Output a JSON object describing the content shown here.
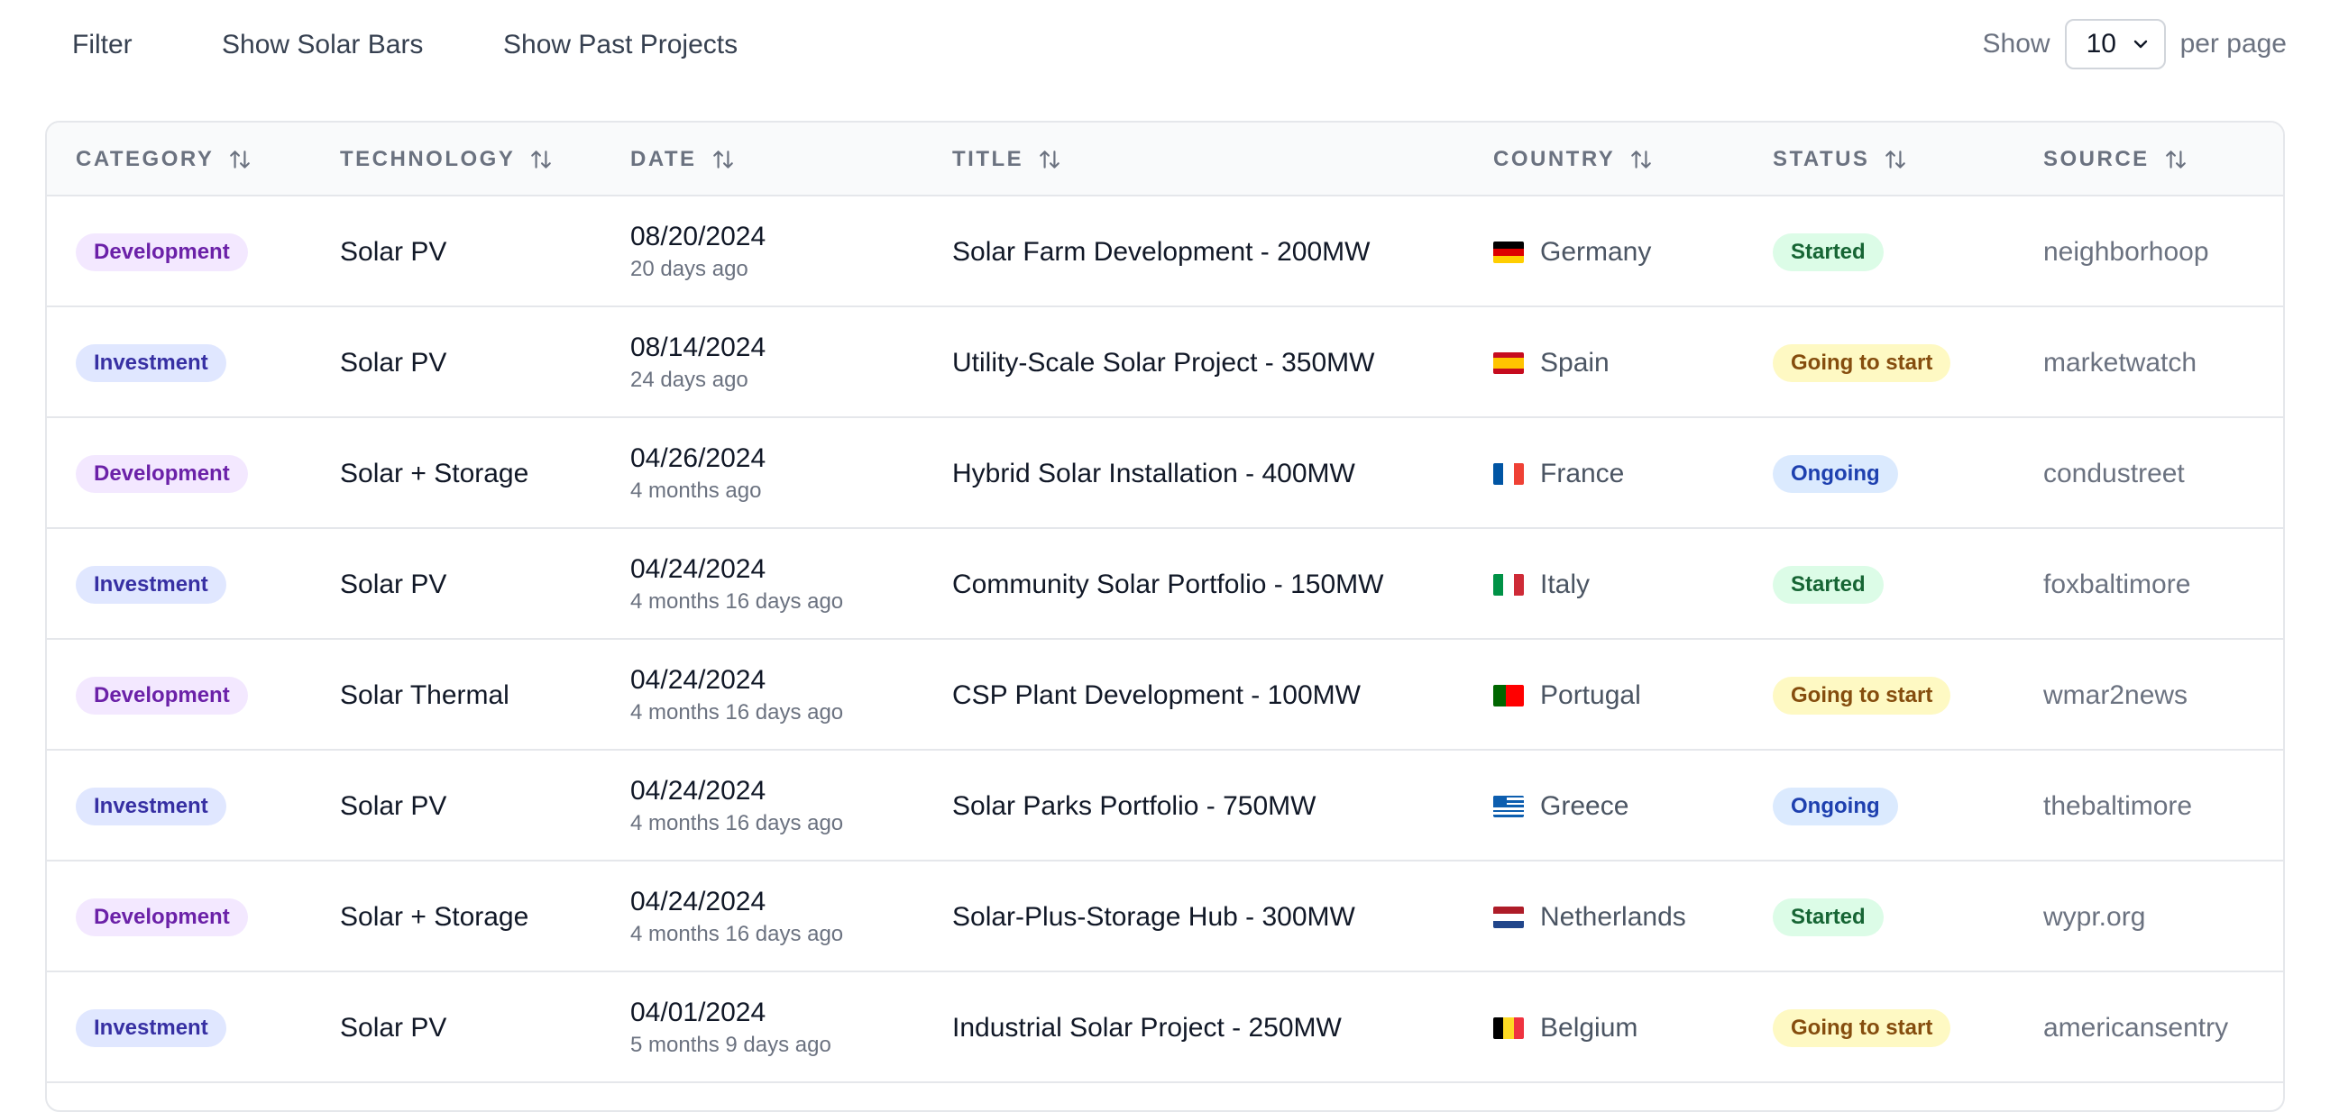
{
  "toolbar": {
    "filter_label": "Filter",
    "solar_bars_label": "Show Solar Bars",
    "past_projects_label": "Show Past Projects",
    "show_label": "Show",
    "per_page_value": "10",
    "per_page_suffix": "per page"
  },
  "table": {
    "headers": [
      "Category",
      "Technology",
      "Date",
      "Title",
      "Country",
      "Status",
      "Source"
    ],
    "rows": [
      {
        "category": "Development",
        "technology": "Solar PV",
        "date": "08/20/2024",
        "relative": "20 days ago",
        "title": "Solar Farm Development - 200MW",
        "country": "Germany",
        "flag": "de",
        "status": "Started",
        "source": "neighborhoop"
      },
      {
        "category": "Investment",
        "technology": "Solar PV",
        "date": "08/14/2024",
        "relative": "24 days ago",
        "title": "Utility-Scale Solar Project - 350MW",
        "country": "Spain",
        "flag": "es",
        "status": "Going to start",
        "source": "marketwatch"
      },
      {
        "category": "Development",
        "technology": "Solar + Storage",
        "date": "04/26/2024",
        "relative": "4 months ago",
        "title": "Hybrid Solar Installation - 400MW",
        "country": "France",
        "flag": "fr",
        "status": "Ongoing",
        "source": "condustreet"
      },
      {
        "category": "Investment",
        "technology": "Solar PV",
        "date": "04/24/2024",
        "relative": "4 months 16 days ago",
        "title": "Community Solar Portfolio - 150MW",
        "country": "Italy",
        "flag": "it",
        "status": "Started",
        "source": "foxbaltimore"
      },
      {
        "category": "Development",
        "technology": "Solar Thermal",
        "date": "04/24/2024",
        "relative": "4 months 16 days ago",
        "title": "CSP Plant Development - 100MW",
        "country": "Portugal",
        "flag": "pt",
        "status": "Going to start",
        "source": "wmar2news"
      },
      {
        "category": "Investment",
        "technology": "Solar PV",
        "date": "04/24/2024",
        "relative": "4 months 16 days ago",
        "title": "Solar Parks Portfolio - 750MW",
        "country": "Greece",
        "flag": "gr",
        "status": "Ongoing",
        "source": "thebaltimore"
      },
      {
        "category": "Development",
        "technology": "Solar + Storage",
        "date": "04/24/2024",
        "relative": "4 months 16 days ago",
        "title": "Solar-Plus-Storage Hub - 300MW",
        "country": "Netherlands",
        "flag": "nl",
        "status": "Started",
        "source": "wypr.org"
      },
      {
        "category": "Investment",
        "technology": "Solar PV",
        "date": "04/01/2024",
        "relative": "5 months 9 days ago",
        "title": "Industrial Solar Project - 250MW",
        "country": "Belgium",
        "flag": "be",
        "status": "Going to start",
        "source": "americansentry"
      }
    ]
  },
  "colors": {
    "development_badge": "#f3e8ff",
    "investment_badge": "#e0e7ff",
    "started_badge": "#dcfce7",
    "going_to_start_badge": "#fef9c3",
    "ongoing_badge": "#dbeafe"
  },
  "icons": {
    "sort": "sort-arrows-icon",
    "select": "chevron-down-icon"
  }
}
